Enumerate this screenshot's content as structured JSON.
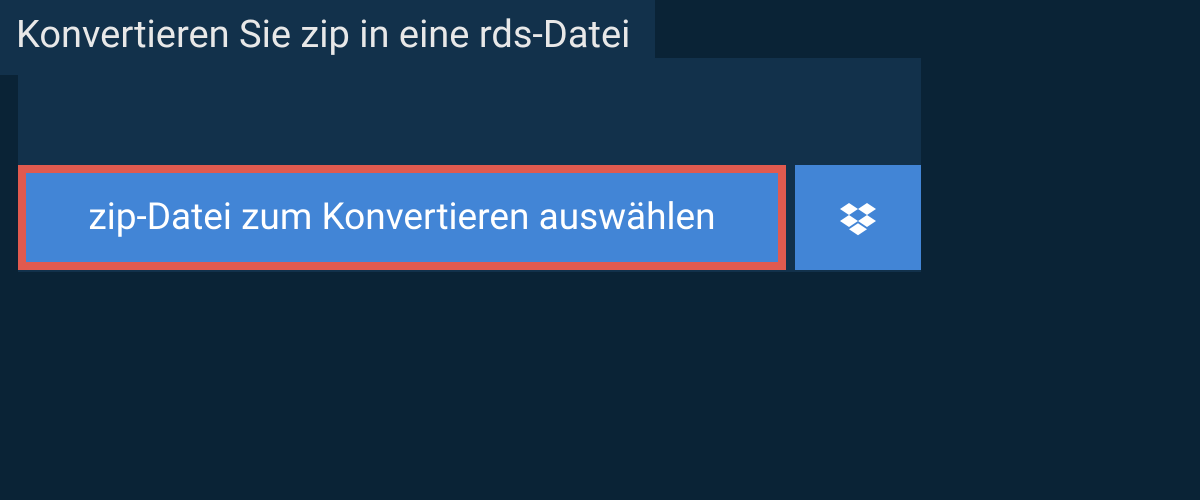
{
  "header": {
    "title": "Konvertieren Sie zip in eine rds-Datei"
  },
  "actions": {
    "select_file_label": "zip-Datei zum Konvertieren auswählen"
  },
  "colors": {
    "page_bg": "#0a2336",
    "card_bg": "#12314b",
    "button_bg": "#4285d6",
    "button_border": "#e05a4f"
  }
}
